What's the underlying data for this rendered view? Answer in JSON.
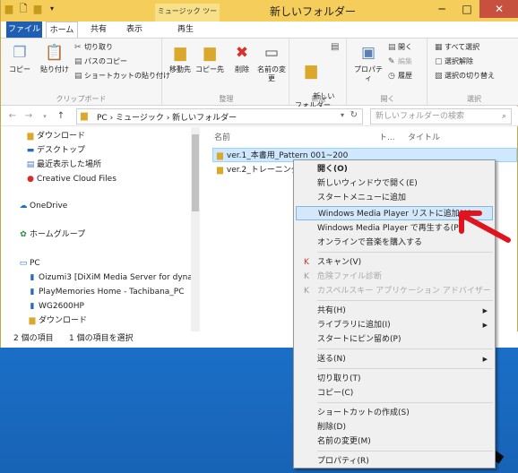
{
  "window": {
    "title": "新しいフォルダー",
    "tool_tab": "ミュージック ツール",
    "minimize": "─",
    "maximize": "□",
    "close": "✕"
  },
  "tabs": {
    "file": "ファイル",
    "home": "ホーム",
    "share": "共有",
    "view": "表示",
    "play": "再生"
  },
  "ribbon": {
    "clipboard": {
      "copy": "コピー",
      "paste": "貼り付け",
      "cut": "切り取り",
      "copy_path": "パスのコピー",
      "paste_shortcut": "ショートカットの貼り付け",
      "label": "クリップボード"
    },
    "organize": {
      "move_to": "移動先",
      "copy_to": "コピー先",
      "delete": "削除",
      "rename": "名前の変更",
      "label": "整理"
    },
    "new": {
      "new_folder": "新しい\nフォルダー",
      "label": "新規"
    },
    "open": {
      "properties": "プロパティ",
      "open": "開く",
      "edit": "編集",
      "history": "履歴",
      "label": "開く"
    },
    "select": {
      "select_all": "すべて選択",
      "select_none": "選択解除",
      "invert": "選択の切り替え",
      "label": "選択"
    }
  },
  "address": {
    "path": "PC  ›  ミュージック  ›  新しいフォルダー",
    "search_placeholder": "新しいフォルダーの検索"
  },
  "nav": [
    {
      "label": "ダウンロード",
      "icon": "folder-icon"
    },
    {
      "label": "デスクトップ",
      "icon": "desktop-icon"
    },
    {
      "label": "最近表示した場所",
      "icon": "recent-icon"
    },
    {
      "label": "Creative Cloud Files",
      "icon": "cloud-icon"
    },
    {
      "label": "OneDrive",
      "icon": "onedrive-icon"
    },
    {
      "label": "ホームグループ",
      "icon": "homegroup-icon"
    },
    {
      "label": "PC",
      "icon": "pc-icon"
    },
    {
      "label": "Oizumi3 [DiXiM Media Server for dyna",
      "icon": "media-server-icon"
    },
    {
      "label": "PlayMemories Home - Tachibana_PC",
      "icon": "media-server-icon"
    },
    {
      "label": "WG2600HP",
      "icon": "media-server-icon"
    },
    {
      "label": "ダウンロード",
      "icon": "folder-icon"
    }
  ],
  "columns": {
    "name": "名前",
    "track": "ト...",
    "title": "タイトル"
  },
  "files": [
    {
      "name": "ver.1_本書用_Pattern 001~200"
    },
    {
      "name": "ver.2_トレーニングプ"
    }
  ],
  "status": {
    "count": "2 個の項目",
    "selected": "1 個の項目を選択"
  },
  "context_menu": [
    {
      "label": "開く(O)",
      "bold": true
    },
    {
      "label": "新しいウィンドウで開く(E)"
    },
    {
      "label": "スタートメニューに追加"
    },
    {
      "label": "Windows Media Player リストに追加(A)",
      "highlight": true
    },
    {
      "label": "Windows Media Player で再生する(P)"
    },
    {
      "label": "オンラインで音楽を購入する"
    },
    {
      "label": "スキャン(V)",
      "icon": "kaspersky-icon"
    },
    {
      "label": "危険ファイル診断",
      "icon": "kaspersky-icon",
      "disabled": true
    },
    {
      "label": "カスペルスキー アプリケーション アドバイザー",
      "icon": "kaspersky-icon",
      "disabled": true
    },
    {
      "label": "共有(H)",
      "sub": true
    },
    {
      "label": "ライブラリに追加(I)",
      "sub": true
    },
    {
      "label": "スタートにピン留め(P)"
    },
    {
      "label": "送る(N)",
      "sub": true
    },
    {
      "label": "切り取り(T)"
    },
    {
      "label": "コピー(C)"
    },
    {
      "label": "ショートカットの作成(S)"
    },
    {
      "label": "削除(D)"
    },
    {
      "label": "名前の変更(M)"
    },
    {
      "label": "プロパティ(R)"
    }
  ],
  "colors": {
    "title_bar": "#f4cd5a",
    "file_tab": "#1e5fb3",
    "highlight": "#d4e8fa",
    "arrow": "#e0141e"
  }
}
